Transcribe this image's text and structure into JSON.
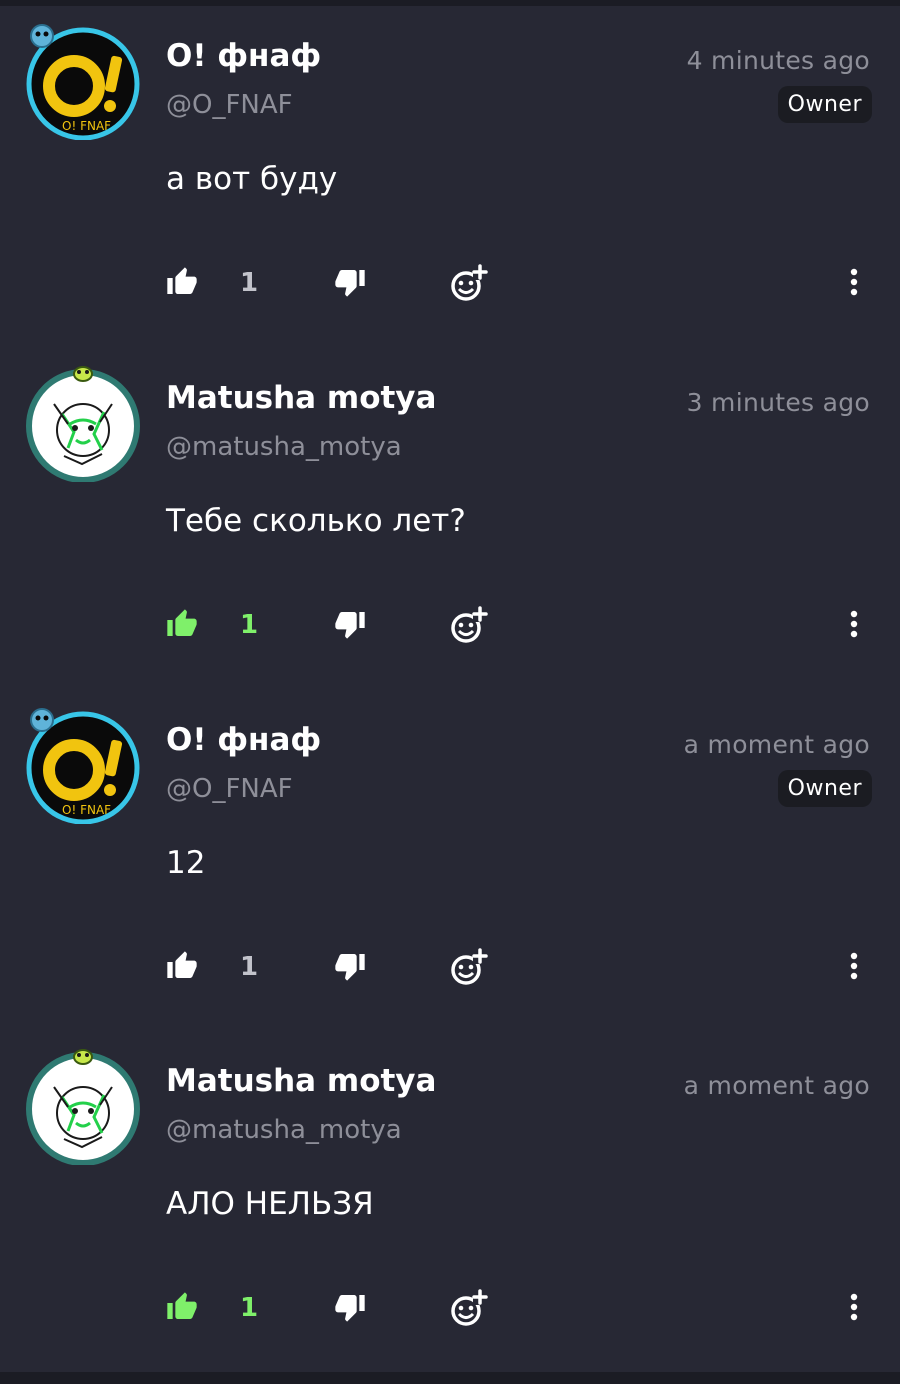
{
  "colors": {
    "background": "#272834",
    "accent_green": "#7ff06a",
    "muted": "#8e8f99"
  },
  "icons": {
    "like": "thumbs-up-icon",
    "dislike": "thumbs-down-icon",
    "react": "add-reaction-icon",
    "more": "more-vertical-icon"
  },
  "comments": [
    {
      "author": "O! фнаф",
      "handle": "@O_FNAF",
      "time": "4 minutes ago",
      "badge": "Owner",
      "text": "а вот буду",
      "likes": "1",
      "liked": false,
      "avatar": "fnaf"
    },
    {
      "author": "Matusha motya",
      "handle": "@matusha_motya",
      "time": "3 minutes ago",
      "badge": "",
      "text": "Тебе сколько лет?",
      "likes": "1",
      "liked": true,
      "avatar": "matusha"
    },
    {
      "author": "O! фнаф",
      "handle": "@O_FNAF",
      "time": "a moment ago",
      "badge": "Owner",
      "text": "12",
      "likes": "1",
      "liked": false,
      "avatar": "fnaf"
    },
    {
      "author": "Matusha motya",
      "handle": "@matusha_motya",
      "time": "a moment ago",
      "badge": "",
      "text": "АЛО НЕЛЬЗЯ",
      "likes": "1",
      "liked": true,
      "avatar": "matusha"
    }
  ]
}
